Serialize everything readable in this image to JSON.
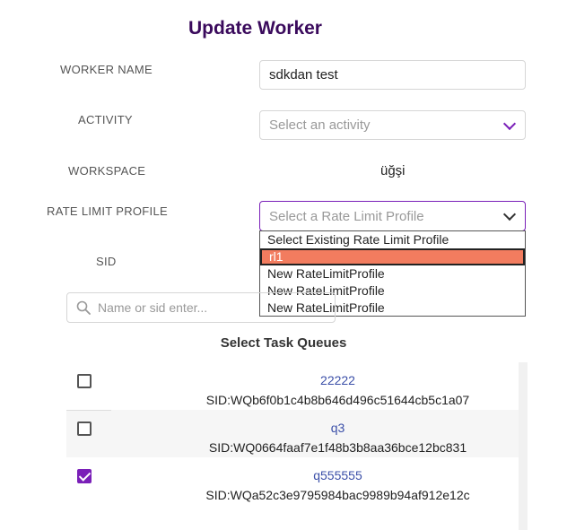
{
  "title": "Update Worker",
  "form": {
    "worker_name": {
      "label": "WORKER NAME",
      "value": "sdkdan test"
    },
    "activity": {
      "label": "ACTIVITY",
      "placeholder": "Select an activity"
    },
    "workspace": {
      "label": "WORKSPACE",
      "value": "üğşi"
    },
    "rate_limit_profile": {
      "label": "RATE LIMIT PROFILE",
      "placeholder": "Select a Rate Limit Profile",
      "options": [
        "Select Existing Rate Limit Profile",
        "rl1",
        "New RateLimitProfile",
        "New RateLimitProfile",
        "New RateLimitProfile"
      ],
      "highlighted_index": 1
    },
    "sid": {
      "label": "SID"
    }
  },
  "search": {
    "placeholder": "Name or sid enter..."
  },
  "task_queues": {
    "title": "Select Task Queues",
    "items": [
      {
        "name": "22222",
        "sid": "SID:WQb6f0b1c4b8b646d496c51644cb5c1a07",
        "checked": false
      },
      {
        "name": "q3",
        "sid": "SID:WQ0664faaf7e1f48b3b8aa36bce12bc831",
        "checked": false
      },
      {
        "name": "q555555",
        "sid": "SID:WQa52c3e9795984bac9989b94af912e12c",
        "checked": true
      }
    ]
  },
  "colors": {
    "accent": "#7a1fb8",
    "title": "#3a0a5c",
    "highlight": "#f27c5f",
    "link": "#3b4fa8"
  }
}
